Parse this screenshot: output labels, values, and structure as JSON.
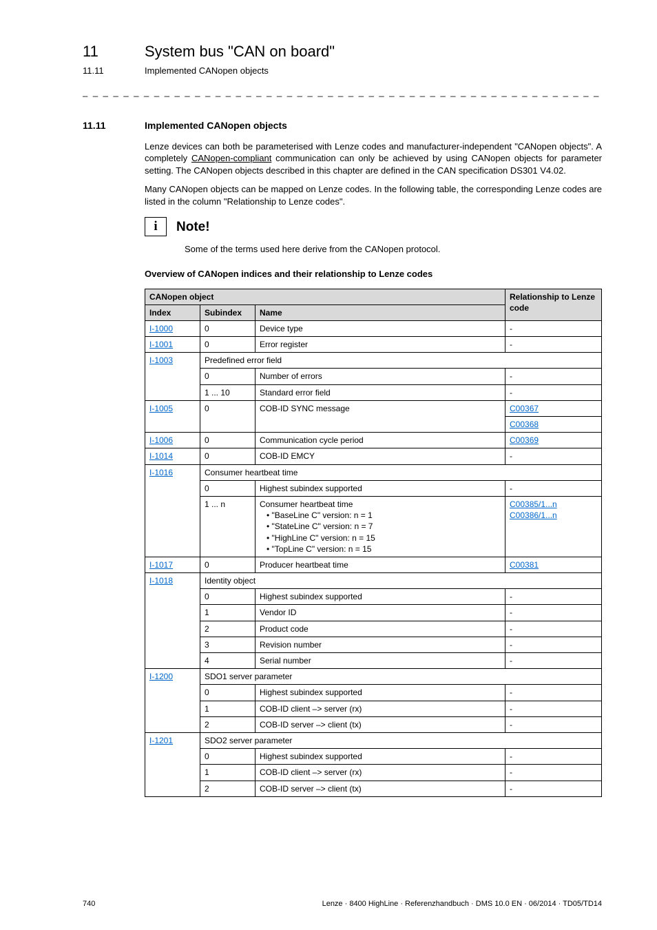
{
  "chapter": {
    "num": "11",
    "title": "System bus \"CAN on board\""
  },
  "subchapter": {
    "num": "11.11",
    "title": "Implemented CANopen objects"
  },
  "section": {
    "num": "11.11",
    "title": "Implemented CANopen objects"
  },
  "para1_a": "Lenze devices can both be parameterised with Lenze codes and manufacturer-independent \"CANopen objects\". A completely ",
  "para1_linked": "CANopen-compliant",
  "para1_b": " communication can only be achieved by using CANopen objects for parameter setting. The CANopen objects described in this chapter are defined in the CAN specification DS301 V4.02.",
  "para2": "Many CANopen objects can be mapped on Lenze codes. In the following table, the corresponding Lenze codes are listed in the column \"Relationship to Lenze codes\".",
  "note": {
    "title": "Note!",
    "body": "Some of the terms used here derive from the CANopen protocol."
  },
  "overview_heading": "Overview of CANopen indices and their relationship to Lenze codes",
  "table": {
    "top_left": "CANopen object",
    "top_right": "Relationship to Lenze code",
    "col_index": "Index",
    "col_sub": "Subindex",
    "col_name": "Name",
    "r": {
      "i1000": "I-1000",
      "i1000_sub": "0",
      "i1000_name": "Device type",
      "i1000_rel": "-",
      "i1001": "I-1001",
      "i1001_sub": "0",
      "i1001_name": "Error register",
      "i1001_rel": "-",
      "i1003": "I-1003",
      "i1003_header": "Predefined error field",
      "i1003a_sub": "0",
      "i1003a_name": "Number of errors",
      "i1003a_rel": "-",
      "i1003b_sub": "1 ... 10",
      "i1003b_name": "Standard error field",
      "i1003b_rel": "-",
      "i1005": "I-1005",
      "i1005_sub": "0",
      "i1005_name": "COB-ID SYNC message",
      "i1005_rel1": "C00367",
      "i1005_rel2": "C00368",
      "i1006": "I-1006",
      "i1006_sub": "0",
      "i1006_name": "Communication cycle period",
      "i1006_rel": "C00369",
      "i1014": "I-1014",
      "i1014_sub": "0",
      "i1014_name": "COB-ID EMCY",
      "i1014_rel": "-",
      "i1016": "I-1016",
      "i1016_header": "Consumer heartbeat time",
      "i1016a_sub": "0",
      "i1016a_name": "Highest subindex supported",
      "i1016a_rel": "-",
      "i1016b_sub": "1 ... n",
      "i1016b_l0": "Consumer heartbeat time",
      "i1016b_l1": "• \"BaseLine C\" version: n = 1",
      "i1016b_l2": "• \"StateLine C\" version: n = 7",
      "i1016b_l3": "• \"HighLine C\" version: n = 15",
      "i1016b_l4": "• \"TopLine C\" version: n = 15",
      "i1016b_rel1": "C00385/1...n",
      "i1016b_rel2": "C00386/1...n",
      "i1017": "I-1017",
      "i1017_sub": "0",
      "i1017_name": "Producer heartbeat time",
      "i1017_rel": "C00381",
      "i1018": "I-1018",
      "i1018_header": "Identity object",
      "i1018a_sub": "0",
      "i1018a_name": "Highest subindex supported",
      "i1018a_rel": "-",
      "i1018b_sub": "1",
      "i1018b_name": "Vendor ID",
      "i1018b_rel": "-",
      "i1018c_sub": "2",
      "i1018c_name": "Product code",
      "i1018c_rel": "-",
      "i1018d_sub": "3",
      "i1018d_name": "Revision number",
      "i1018d_rel": "-",
      "i1018e_sub": "4",
      "i1018e_name": "Serial number",
      "i1018e_rel": "-",
      "i1200": "I-1200",
      "i1200_header": "SDO1 server parameter",
      "i1200a_sub": "0",
      "i1200a_name": "Highest subindex supported",
      "i1200a_rel": "-",
      "i1200b_sub": "1",
      "i1200b_name": "COB-ID client –> server (rx)",
      "i1200b_rel": "-",
      "i1200c_sub": "2",
      "i1200c_name": "COB-ID server –> client (tx)",
      "i1200c_rel": "-",
      "i1201": "I-1201",
      "i1201_header": "SDO2 server parameter",
      "i1201a_sub": "0",
      "i1201a_name": "Highest subindex supported",
      "i1201a_rel": "-",
      "i1201b_sub": "1",
      "i1201b_name": "COB-ID client –> server (rx)",
      "i1201b_rel": "-",
      "i1201c_sub": "2",
      "i1201c_name": "COB-ID server –> client (tx)",
      "i1201c_rel": "-"
    }
  },
  "footer": {
    "page": "740",
    "info": "Lenze · 8400 HighLine · Referenzhandbuch · DMS 10.0 EN · 06/2014 · TD05/TD14"
  }
}
